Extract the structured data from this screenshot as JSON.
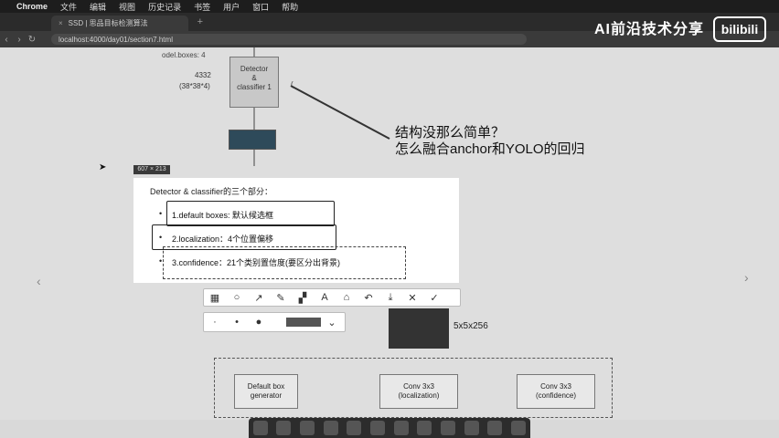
{
  "menubar": {
    "app": "Chrome",
    "items": [
      "文件",
      "编辑",
      "视图",
      "历史记录",
      "书签",
      "用户",
      "窗口",
      "帮助"
    ]
  },
  "tab": {
    "title": "SSD | 思品目标检测算法"
  },
  "address": {
    "url": "localhost:4000/day01/section7.html"
  },
  "watermark": {
    "text": "AI前沿技术分享",
    "logo": "bilibili"
  },
  "slide": {
    "top_truncated": "odel.boxes: 4",
    "detector_box": "Detector\n&\nclassifier 1",
    "dim_a": "4332",
    "dim_b": "(38*38*4)",
    "paren": "(",
    "note_line1": "结构没那么简单？",
    "note_line2": "怎么融合anchor和YOLO的回归",
    "counter": "607 × 213",
    "panel_title": "Detector & classifier的三个部分：",
    "items": [
      "1.default boxes: 默认候选框",
      "2.localization：4个位置偏移",
      "3.confidence：21个类别置信度(要区分出背景)"
    ],
    "dim_c": "5x5x256",
    "bottom_boxes": [
      "Default box\ngenerator",
      "Conv 3x3\n(localization)",
      "Conv 3x3\n(confidence)"
    ]
  },
  "toolbar": {
    "icons": [
      "mosaic-icon",
      "circle-icon",
      "arrow-icon",
      "pencil-icon",
      "blur-icon",
      "text-icon",
      "tag-icon",
      "undo-icon",
      "download-icon",
      "close-icon",
      "confirm-icon"
    ],
    "glyphs": [
      "▦",
      "○",
      "↗",
      "✎",
      "▞",
      "A",
      "⌂",
      "↶",
      "⤓",
      "✕",
      "✓"
    ]
  },
  "colors": {
    "menubar": "#1d1d1d",
    "slide_bg": "#dedede",
    "panel": "#ffffff"
  }
}
